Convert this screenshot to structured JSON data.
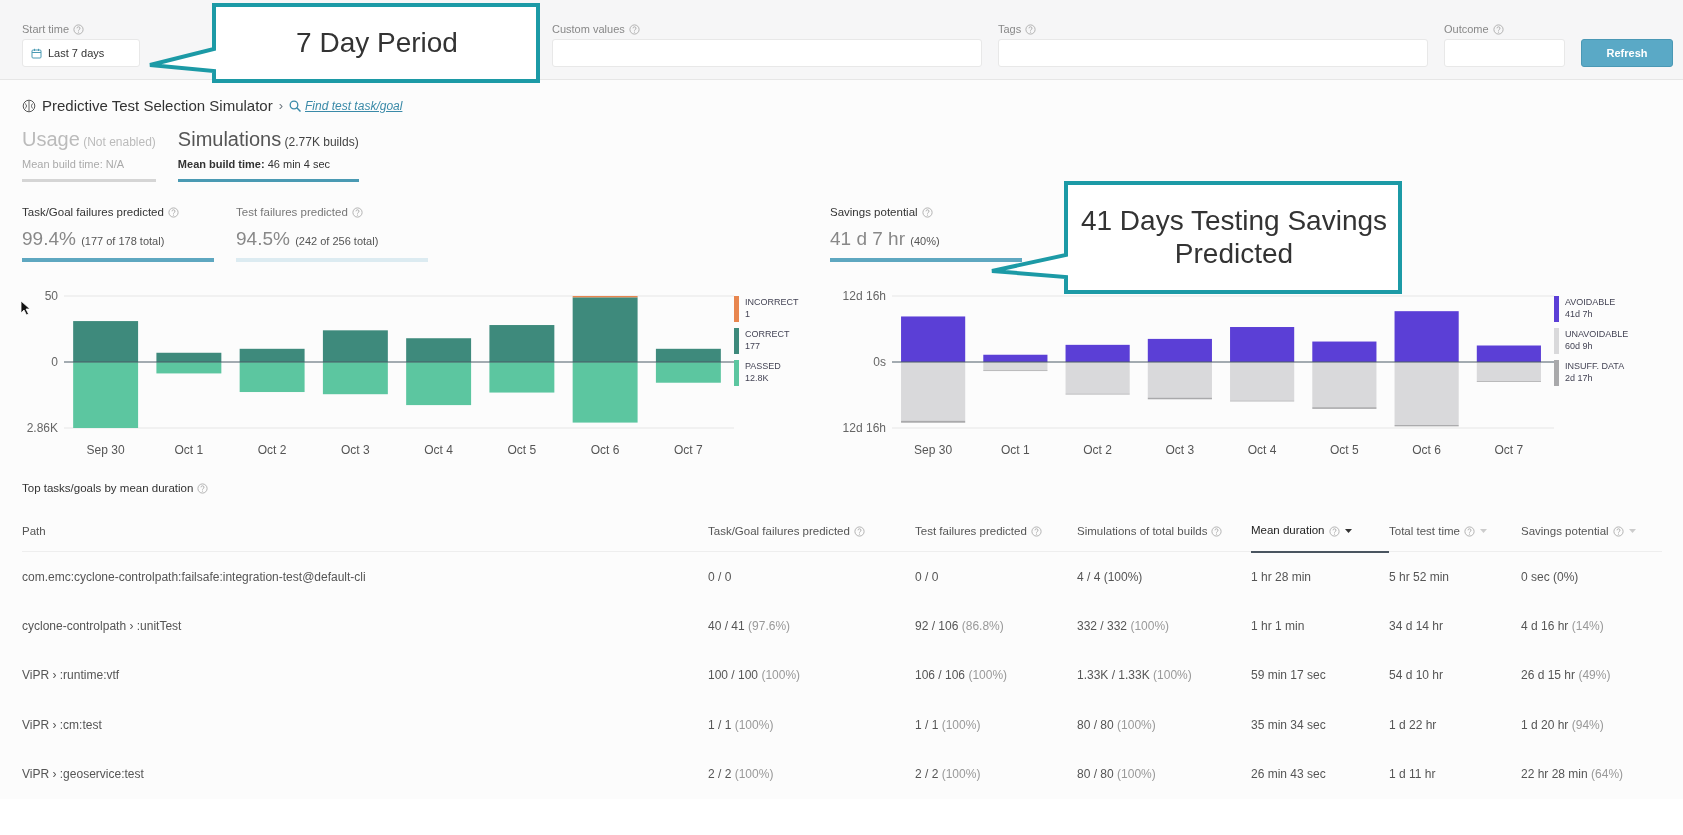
{
  "filters": [
    {
      "kind": "date",
      "label": "Start time",
      "value": "Last 7 days"
    },
    {
      "kind": "text",
      "label": "Custom values"
    },
    {
      "kind": "text",
      "label": "Tags"
    },
    {
      "kind": "text",
      "label": "Outcome"
    }
  ],
  "refresh_button": "Refresh",
  "callouts": [
    {
      "text": "7 Day Period"
    },
    {
      "text": "41 Days Testing Savings Predicted"
    }
  ],
  "breadcrumb": {
    "title": "Predictive Test Selection Simulator",
    "separator": "›",
    "link": "Find test task/goal"
  },
  "tabs": [
    {
      "label": "Usage",
      "note": "(Not enabled)",
      "sub": "Mean build time: N/A",
      "selected": false
    },
    {
      "label": "Simulations",
      "note": "(2.77K builds)",
      "sub": "**Mean build time:** 46 min 4 sec",
      "selected": true
    }
  ],
  "panels": [
    {
      "metrics": [
        {
          "label": "Task/Goal failures predicted",
          "value": "99.4%",
          "detail": "(177 of 178 total)",
          "selected": true
        },
        {
          "label": "Test failures predicted",
          "value": "94.5%",
          "detail": "(242 of 256 total)",
          "selected": false
        }
      ],
      "chart": {
        "y_labels": [
          "50",
          "0",
          "2.86K"
        ],
        "categories": [
          "Sep 30",
          "Oct 1",
          "Oct 2",
          "Oct 3",
          "Oct 4",
          "Oct 5",
          "Oct 6",
          "Oct 7"
        ],
        "legend": [
          {
            "label": "INCORRECT",
            "value": "1",
            "color": "#e8864f"
          },
          {
            "label": "CORRECT",
            "value": "177",
            "color": "#3e8a7c"
          },
          {
            "label": "PASSED",
            "value": "12.8K",
            "color": "#5cc6a0"
          }
        ]
      }
    },
    {
      "metrics": [
        {
          "label": "Savings potential",
          "value": "41 d 7 hr",
          "detail": "(40%)",
          "selected": true
        }
      ],
      "chart": {
        "y_labels": [
          "12d 16h",
          "0s",
          "12d 16h"
        ],
        "categories": [
          "Sep 30",
          "Oct 1",
          "Oct 2",
          "Oct 3",
          "Oct 4",
          "Oct 5",
          "Oct 6",
          "Oct 7"
        ],
        "legend": [
          {
            "label": "AVOIDABLE",
            "value": "41d 7h",
            "color": "#5b3fd6"
          },
          {
            "label": "UNAVOIDABLE",
            "value": "60d 9h",
            "color": "#d9d9db"
          },
          {
            "label": "INSUFF. DATA",
            "value": "2d 17h",
            "color": "#a9a9ab"
          }
        ]
      }
    }
  ],
  "table": {
    "title": "Top tasks/goals by mean duration",
    "columns": [
      {
        "label": "Path",
        "help": false,
        "sortable": false,
        "selected": false
      },
      {
        "label": "Task/Goal failures predicted",
        "help": true,
        "sortable": false,
        "selected": false
      },
      {
        "label": "Test failures predicted",
        "help": true,
        "sortable": false,
        "selected": false
      },
      {
        "label": "Simulations of total builds",
        "help": true,
        "sortable": false,
        "selected": false
      },
      {
        "label": "Mean duration",
        "help": true,
        "sortable": true,
        "selected": true
      },
      {
        "label": "Total test time",
        "help": true,
        "sortable": true,
        "selected": false
      },
      {
        "label": "Savings potential",
        "help": true,
        "sortable": true,
        "selected": false
      }
    ],
    "rows": [
      [
        {
          "text": "com.emc:cyclone-controlpath:failsafe:integration-test@default-cli"
        },
        {
          "text": "0 / 0"
        },
        {
          "text": "0 / 0"
        },
        {
          "text": "4 / 4 (100%)"
        },
        {
          "text": "1 hr 28 min"
        },
        {
          "text": "5 hr 52 min"
        },
        {
          "text": "0 sec (0%)"
        }
      ],
      [
        {
          "text": "cyclone-controlpath › :unitTest"
        },
        {
          "text": "40 / 41",
          "note": "(97.6%)"
        },
        {
          "text": "92 / 106",
          "note": "(86.8%)"
        },
        {
          "text": "332 / 332",
          "note": "(100%)"
        },
        {
          "text": "1 hr 1 min"
        },
        {
          "text": "34 d 14 hr"
        },
        {
          "text": "4 d 16 hr",
          "note": "(14%)"
        }
      ],
      [
        {
          "text": "ViPR › :runtime:vtf"
        },
        {
          "text": "100 / 100",
          "note": "(100%)"
        },
        {
          "text": "106 / 106",
          "note": "(100%)"
        },
        {
          "text": "1.33K / 1.33K",
          "note": "(100%)"
        },
        {
          "text": "59 min 17 sec"
        },
        {
          "text": "54 d 10 hr"
        },
        {
          "text": "26 d 15 hr",
          "note": "(49%)"
        }
      ],
      [
        {
          "text": "ViPR › :cm:test"
        },
        {
          "text": "1 / 1",
          "note": "(100%)"
        },
        {
          "text": "1 / 1",
          "note": "(100%)"
        },
        {
          "text": "80 / 80",
          "note": "(100%)"
        },
        {
          "text": "35 min 34 sec"
        },
        {
          "text": "1 d 22 hr"
        },
        {
          "text": "1 d 20 hr",
          "note": "(94%)"
        }
      ],
      [
        {
          "text": "ViPR › :geoservice:test"
        },
        {
          "text": "2 / 2",
          "note": "(100%)"
        },
        {
          "text": "2 / 2",
          "note": "(100%)"
        },
        {
          "text": "80 / 80",
          "note": "(100%)"
        },
        {
          "text": "26 min 43 sec"
        },
        {
          "text": "1 d 11 hr"
        },
        {
          "text": "22 hr 28 min",
          "note": "(64%)"
        }
      ]
    ]
  }
}
